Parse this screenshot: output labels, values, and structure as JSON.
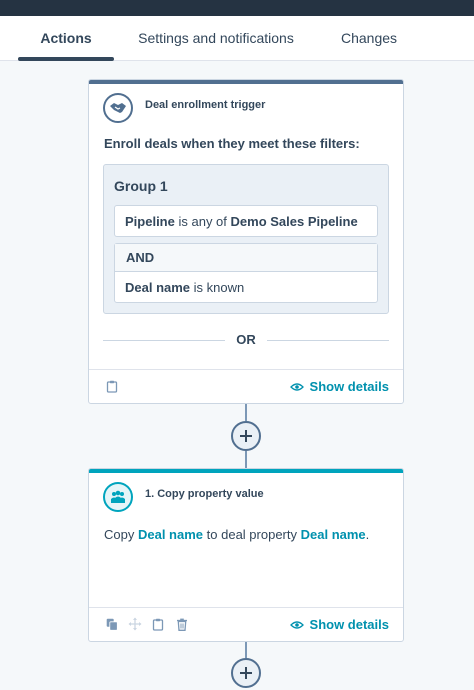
{
  "tabs": [
    {
      "label": "Actions",
      "active": true
    },
    {
      "label": "Settings and notifications",
      "active": false
    },
    {
      "label": "Changes",
      "active": false
    }
  ],
  "trigger_card": {
    "title": "Deal enrollment trigger",
    "icon": "handshake-icon",
    "heading": "Enroll deals when they meet these filters:",
    "group_title": "Group 1",
    "filter1": {
      "property": "Pipeline",
      "operator": "is any of",
      "value": "Demo Sales Pipeline"
    },
    "and_label": "AND",
    "filter2": {
      "property": "Deal name",
      "operator": "is known"
    },
    "or_label": "OR",
    "show_details": "Show details",
    "footer_icons": [
      "clipboard-icon"
    ]
  },
  "action_card": {
    "title": "1. Copy property value",
    "icon": "people-icon",
    "text_prefix": "Copy",
    "source_property": "Deal name",
    "text_middle": "to deal property",
    "target_property": "Deal name",
    "text_suffix": ".",
    "show_details": "Show details",
    "footer_icons": [
      "copy-icon",
      "move-icon",
      "clipboard-icon",
      "delete-icon"
    ]
  },
  "colors": {
    "topbar": "#253342",
    "trigger_accent": "#516f90",
    "action_accent": "#00a4bd",
    "link": "#0091ae",
    "text": "#33475b",
    "border": "#cbd6e2"
  }
}
